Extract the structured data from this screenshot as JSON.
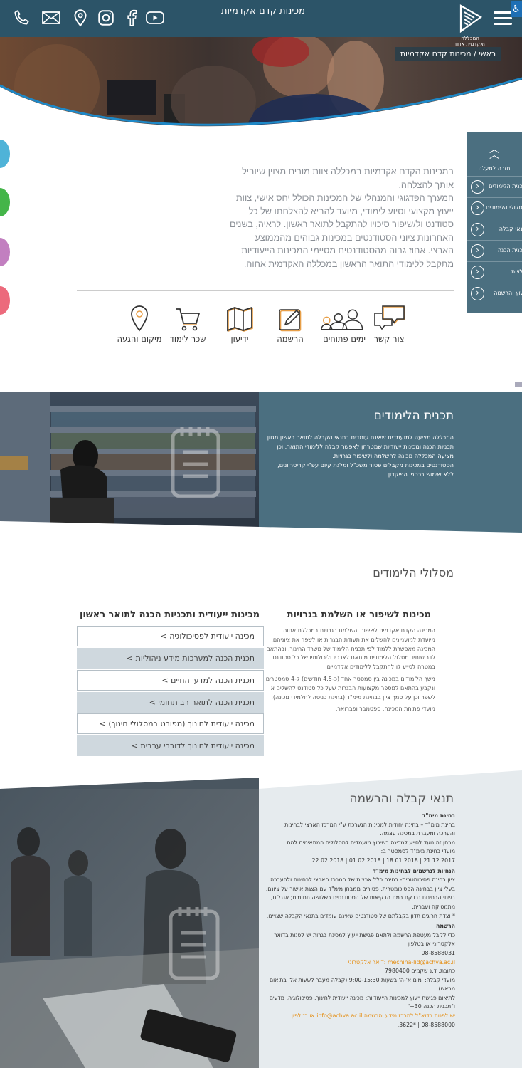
{
  "header": {
    "title": "מכינות קדם אקדמיות",
    "logo_text": "המכללה האקדמית אחוה",
    "breadcrumb": "ראשי / מכינות קדם אקדמיות"
  },
  "side_menu": {
    "back_label": "חזרה למעלה",
    "items": [
      "תכנית הלימודים",
      "מסלולי הלימודים",
      "תנאי קבלה",
      "תכנית הכנה",
      "עלויות",
      "ייעוץ והרשמה"
    ]
  },
  "intro": {
    "paragraphs": [
      "במכינות הקדם אקדמיות במכללה צוות מורים מצוין שיוביל אותך להצלחה.",
      "המערך הפדגוגי והמנהלי של המכינות הכולל יחס אישי, צוות ייעוץ מקצועי וסיוע לימודי, מיועד להביא להצלחתו של כל סטודנט ול/שיפור סיכויו להתקבל לתואר ראשון. לראיה, בשנים האחרונות ציוני הסטודנטים במכינות גבוהים מהממוצע הארצי. אחוז גבוה מהסטודנטים מסיימי המכינות הייעודיות מתקבל ללימודי התואר הראשון במכללה האקדמית אחוה."
    ]
  },
  "quick_links": [
    {
      "label": "צור קשר",
      "icon": "chat-icon"
    },
    {
      "label": "ימים פתוחים",
      "icon": "people-icon"
    },
    {
      "label": "הרשמה",
      "icon": "pencil-icon"
    },
    {
      "label": "ידיעון",
      "icon": "map-book-icon"
    },
    {
      "label": "שכר לימוד",
      "icon": "cart-icon"
    },
    {
      "label": "מיקום והגעה",
      "icon": "location-pin-icon"
    }
  ],
  "study_plan": {
    "title": "תכנית הלימודים",
    "text": [
      "המכללה מציעה למועמדים שאינם עומדים בתנאי הקבלה לתואר ראשון מגוון תכניות הכנה ומכינות ייעודיות שמטרתן לאפשר קבלה ללימודי התואר. וכן מציעה המכללה מכינה להשלמה ולשיפור בגרויות.",
      "הסטודנטים במכינות מקבלים פטור משכ\"ל ומלגת קיום עפ\"י קריטריונים, ללא שימוש בכספי הפיקדון."
    ]
  },
  "tracks": {
    "title": "מסלולי הלימודים",
    "left_col": {
      "title": "מכינות ייעודית ותכניות הכנה לתואר ראשון",
      "buttons": [
        "מכינה ייעודית לפסיכולוגיה >",
        "תכנית הכנה למערכות מידע ניהוליות >",
        "תכנית הכנה למדעי החיים >",
        "תכנית הכנה לתואר רב תחומי >",
        "מכינה ייעודית לחינוך (מפורט במסלולי חינוך) >",
        "מכינה ייעודית לחינוך לדוברי ערבית >"
      ]
    },
    "right_col": {
      "title": "מכינות לשיפור או השלמת בגרויות",
      "paragraphs": [
        "המכינה הקדם אקדמית לשיפור והשלמת בגרויות במכללת אחוה מיועדת למועניינים להשלים את תעודת הבגרות או לשפר את ציוניהם. המכינה מאפשרת ללמוד לפי תכנית הלימוד של משרד החינוך, ובהתאם לדרישותיו. מסלול הלימודים מותאם לצרכיו וליכולותיו של כל סטודנט במטרה לסייע לו להתקבל ללימודים אקדמיים.",
        "משך הלימודים במכינה בין סמסטר אחד (כ-4.5 חודשים) ל-4 סמסטרים ונקבע בהתאם למספר מקצועות הבגרות שעל כל סטודנט להשלים או לשפר וכן על סמך ציון בבחינת מימ\"ד (בחינת כניסה לתלמידי מכינה).",
        "מועדי פתיחת המכינה: ספטמבר ופברואר."
      ]
    }
  },
  "registration": {
    "title": "תנאי קבלה והרשמה",
    "lines": [
      {
        "t": "בחינת מימ\"ד",
        "s": "b"
      },
      {
        "t": "בחינת מימ\"ד – בחינה יחודית למכינות הנערכת ע\"י המרכז הארצי לבחינות והערכה ומעברת במכינה עצמה.",
        "s": ""
      },
      {
        "t": "מבחן זה נועד לסייע למכינה בשיבוץ מועמדים למסלולים המתאימים להם.",
        "s": ""
      },
      {
        "t": "מועדי בחינת מימ\"ד לסמסטר ב:",
        "s": ""
      },
      {
        "t": "21.12.2017 | 18.01.2018 | 01.02.2018 | 22.02.2018",
        "s": ""
      },
      {
        "t": "הנחיות לנרשמים לבחינות מימ\"ד",
        "s": "b"
      },
      {
        "t": "ציון בחינה פסיכומטרית- בחינה כלל ארצית של המרכז הארצי לבחינות ולהערכה. בעלי ציון בבחינה הפסיכומטרית, פטורים ממבחן מימ\"ד עם הצגת אישור על ציונם.",
        "s": ""
      },
      {
        "t": "בשתי הבחינות נבדקת רמת הבקיאות של הסטודנטים בשלושה תחומים; אנגלית, מתמטיקה ועברית.",
        "s": ""
      },
      {
        "t": "* וצדת חריגים תדון בקבלתם של סטודנטים שאינם עומדים בתנאי הקבלה שצויינו.",
        "s": ""
      },
      {
        "t": "הרשמה",
        "s": "b"
      },
      {
        "t": "כדי לקבל מעטפת הרשמה ולתאם פגישת ייעוץ למכינת בגרות יש לפנות בדואר אלקטרוני או בטלפון",
        "s": ""
      },
      {
        "t": "08-8588031",
        "s": ""
      },
      {
        "t": "mechina-lid@achva.ac.il :דואר אלקטרוני",
        "s": "o"
      },
      {
        "t": "כתובת: ד.נ שקמים 7980400",
        "s": ""
      },
      {
        "t": "מועדי קבלה: ימים א'-ה' בשעות 9:00-15:30 (קבלה מעבר לשעות אלו בתיאום מראש).",
        "s": ""
      },
      {
        "t": "לתיאום פגישת ייעוץ למכינות הייעודיות: מכינה ייעודית לחינוך, פסיכולוגיה, מדעים ו\"תכנית הכנה 30+\"",
        "s": ""
      },
      {
        "t": "יש לפנות בדוא\"ל למרכז מידע והרשמה info@achva.ac.il או בטלפון:",
        "s": "o"
      },
      {
        "t": "08-8588000 | *3622.",
        "s": ""
      }
    ]
  },
  "colors": {
    "primary": "#2c5468",
    "panel": "#4b6f80",
    "accent_orange": "#e58e12",
    "button_gray": "#cfd8de"
  }
}
